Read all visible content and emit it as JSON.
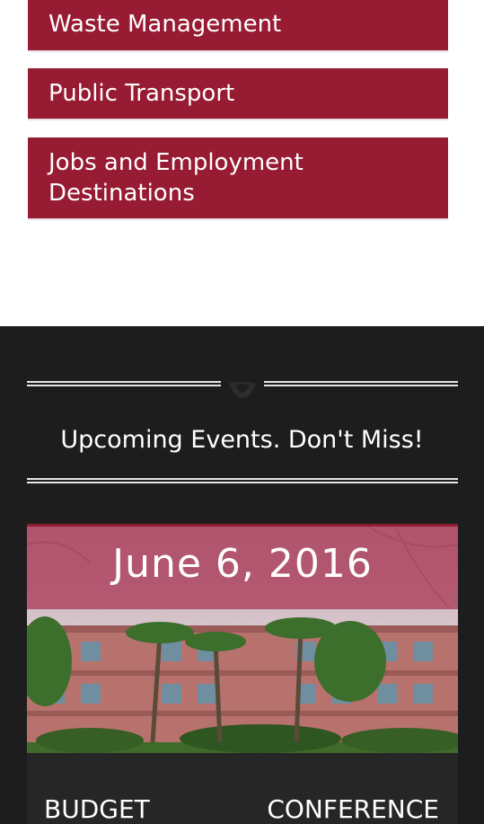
{
  "links": [
    {
      "label": "Waste Management"
    },
    {
      "label": "Public Transport"
    },
    {
      "label": "Jobs and Employment Destinations"
    }
  ],
  "events": {
    "heading": "Upcoming Events. Don't Miss!",
    "card": {
      "date": "June 6, 2016",
      "title_left": "BUDGET",
      "title_right": "CONFERENCE"
    }
  },
  "colors": {
    "brand": "#971b32",
    "dark_bg": "#1d1d1d",
    "card_bg": "#262626"
  }
}
